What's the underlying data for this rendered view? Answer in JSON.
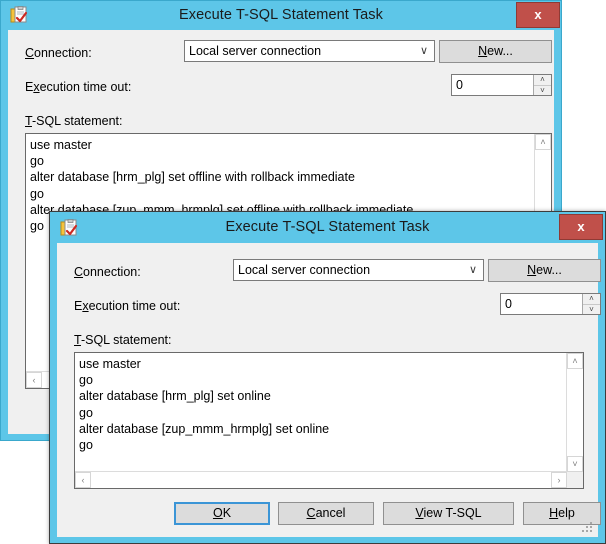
{
  "theme": {
    "frame_color": "#5dc6e8",
    "client_color": "#f0f0f0",
    "close_button_color": "#c0504a",
    "default_button_border": "#3b95d6"
  },
  "back_dialog": {
    "title": "Execute T-SQL Statement Task",
    "icon": "execute-tsql-task-icon",
    "close_label": "x",
    "connection_label": "Connection:",
    "connection_label_parts": {
      "accel": "C",
      "rest": "onnection:"
    },
    "connection_value": "Local server connection",
    "connection_options": [
      "Local server connection"
    ],
    "combo_arrow": "∨",
    "new_button_label": "New...",
    "new_button_parts": {
      "accel": "N",
      "rest": "ew..."
    },
    "timeout_label": "Execution time out:",
    "timeout_label_parts": {
      "pre": "E",
      "accel": "x",
      "rest": "ecution time out:"
    },
    "timeout_value": "0",
    "spin_up": "˄",
    "spin_down": "˅",
    "statement_label": "T-SQL statement:",
    "statement_label_parts": {
      "accel": "T",
      "rest": "-SQL statement:"
    },
    "statement_text": "use master\ngo\nalter database [hrm_plg] set offline with rollback immediate\ngo\nalter database [zup_mmm_hrmplg] set offline with rollback immediate\ngo",
    "scroll_up": "˄",
    "scroll_down": "˅",
    "scroll_left": "‹",
    "scroll_right": "›"
  },
  "front_dialog": {
    "title": "Execute T-SQL Statement Task",
    "icon": "execute-tsql-task-icon",
    "close_label": "x",
    "connection_label": "Connection:",
    "connection_label_parts": {
      "accel": "C",
      "rest": "onnection:"
    },
    "connection_value": "Local server connection",
    "connection_options": [
      "Local server connection"
    ],
    "combo_arrow": "∨",
    "new_button_label": "New...",
    "new_button_parts": {
      "accel": "N",
      "rest": "ew..."
    },
    "timeout_label": "Execution time out:",
    "timeout_label_parts": {
      "pre": "E",
      "accel": "x",
      "rest": "ecution time out:"
    },
    "timeout_value": "0",
    "spin_up": "˄",
    "spin_down": "˅",
    "statement_label": "T-SQL statement:",
    "statement_label_parts": {
      "accel": "T",
      "rest": "-SQL statement:"
    },
    "statement_text": "use master\ngo\nalter database [hrm_plg] set online\ngo\nalter database [zup_mmm_hrmplg] set online\ngo",
    "scroll_up": "˄",
    "scroll_down": "˅",
    "scroll_left": "‹",
    "scroll_right": "›",
    "buttons": {
      "ok": {
        "label": "OK",
        "accel": "O",
        "rest": "K",
        "is_default": true
      },
      "cancel": {
        "label": "Cancel",
        "accel": "C",
        "rest": "ancel"
      },
      "view_tsql": {
        "label": "View T-SQL",
        "accel": "V",
        "rest": "iew T-SQL"
      },
      "help": {
        "label": "Help",
        "accel": "H",
        "rest": "elp"
      }
    }
  }
}
